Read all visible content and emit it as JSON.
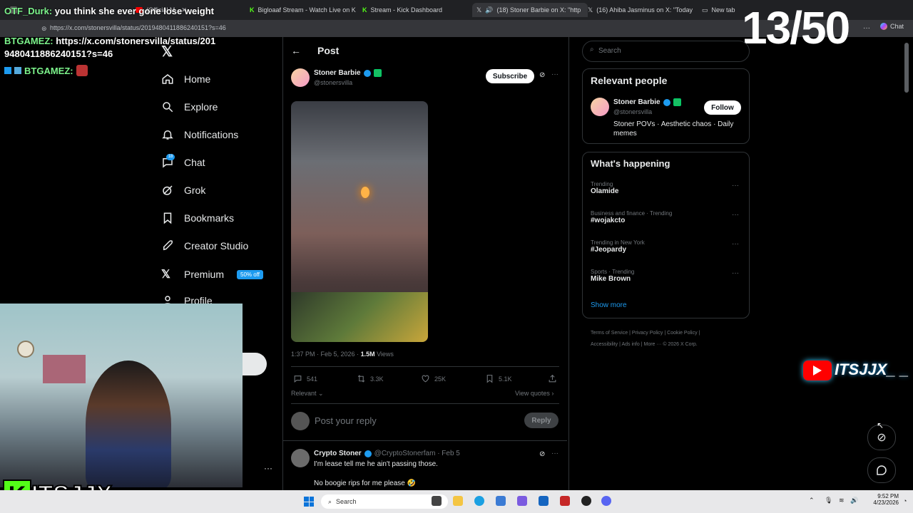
{
  "tabs": [
    {
      "label": "",
      "active": false
    },
    {
      "label": "(Official M",
      "active": false
    },
    {
      "label": "Bigloaaf Stream - Watch Live on K",
      "active": false
    },
    {
      "label": "Stream - Kick Dashboard",
      "active": false
    },
    {
      "label": "(18) Stoner Barbie on X: \"http",
      "active": true
    },
    {
      "label": "(16) Ahiba Jasminus on X: \"Today",
      "active": false
    },
    {
      "label": "New tab",
      "active": false
    }
  ],
  "address_url": "https://x.com/stonersvilla/status/2019480411886240151?s=46",
  "browser_chat_label": "Chat",
  "counter": "13/50",
  "overlay_chat": [
    {
      "name": "OTF_Durk:",
      "text": "you think she ever gone lose weight"
    },
    {
      "name": "BTGAMEZ:",
      "text": "https://x.com/stonersvilla/status/2019480411886240151?s=46"
    },
    {
      "name": "BTGAMEZ:",
      "text": ""
    }
  ],
  "nav": {
    "items": [
      {
        "label": "Home",
        "icon": "home-icon"
      },
      {
        "label": "Explore",
        "icon": "search-icon"
      },
      {
        "label": "Notifications",
        "icon": "bell-icon"
      },
      {
        "label": "Chat",
        "icon": "chat-icon"
      },
      {
        "label": "Grok",
        "icon": "grok-icon"
      },
      {
        "label": "Bookmarks",
        "icon": "bookmark-icon"
      },
      {
        "label": "Creator Studio",
        "icon": "rocket-icon"
      },
      {
        "label": "Premium",
        "icon": "x-logo-icon"
      },
      {
        "label": "Profile",
        "icon": "person-icon"
      }
    ],
    "chat_badge": "18",
    "premium_badge": "50% off"
  },
  "post": {
    "header": "Post",
    "author_name": "Stoner Barbie",
    "author_handle": "@stonersvilla",
    "subscribe_label": "Subscribe",
    "timestamp": "1:37 PM · Feb 5, 2026 · ",
    "views_count": "1.5M",
    "views_label": " Views",
    "stats": {
      "replies": "541",
      "reposts": "3.3K",
      "likes": "25K",
      "bookmarks": "5.1K"
    },
    "sort_label": "Relevant",
    "view_quotes_label": "View quotes",
    "reply_placeholder": "Post your reply",
    "reply_button": "Reply"
  },
  "reply": {
    "name": "Crypto Stoner",
    "handle": "@CryptoStonerfam · Feb 5",
    "line1": "I'm lease tell me he ain't passing those.",
    "line2": "No boogie rips for me please 🤣"
  },
  "right": {
    "search_placeholder": "Search",
    "relevant_title": "Relevant people",
    "person_name": "Stoner Barbie",
    "person_handle": "@stonersvilla",
    "follow_label": "Follow",
    "person_bio": "Stoner POVs · Aesthetic chaos · Daily memes",
    "happening_title": "What's happening",
    "trends": [
      {
        "category": "Trending",
        "topic": "Olamide"
      },
      {
        "category": "Business and finance · Trending",
        "topic": "#wojakcto"
      },
      {
        "category": "Trending in New York",
        "topic": "#Jeopardy"
      },
      {
        "category": "Sports · Trending",
        "topic": "Mike Brown"
      }
    ],
    "show_more": "Show more",
    "footer_links": [
      "Terms of Service",
      "Privacy Policy",
      "Cookie Policy",
      "Accessibility",
      "Ads info",
      "More ···",
      "© 2026 X Corp."
    ]
  },
  "youtube_overlay": "ITSJJX_ _",
  "kick_overlay": "ITSJJX",
  "taskbar": {
    "search_label": "Search",
    "time": "9:52 PM",
    "date": "4/23/2026"
  },
  "colors": {
    "accent": "#1d9bf0",
    "kick_green": "#53fc18",
    "background": "#000000"
  }
}
